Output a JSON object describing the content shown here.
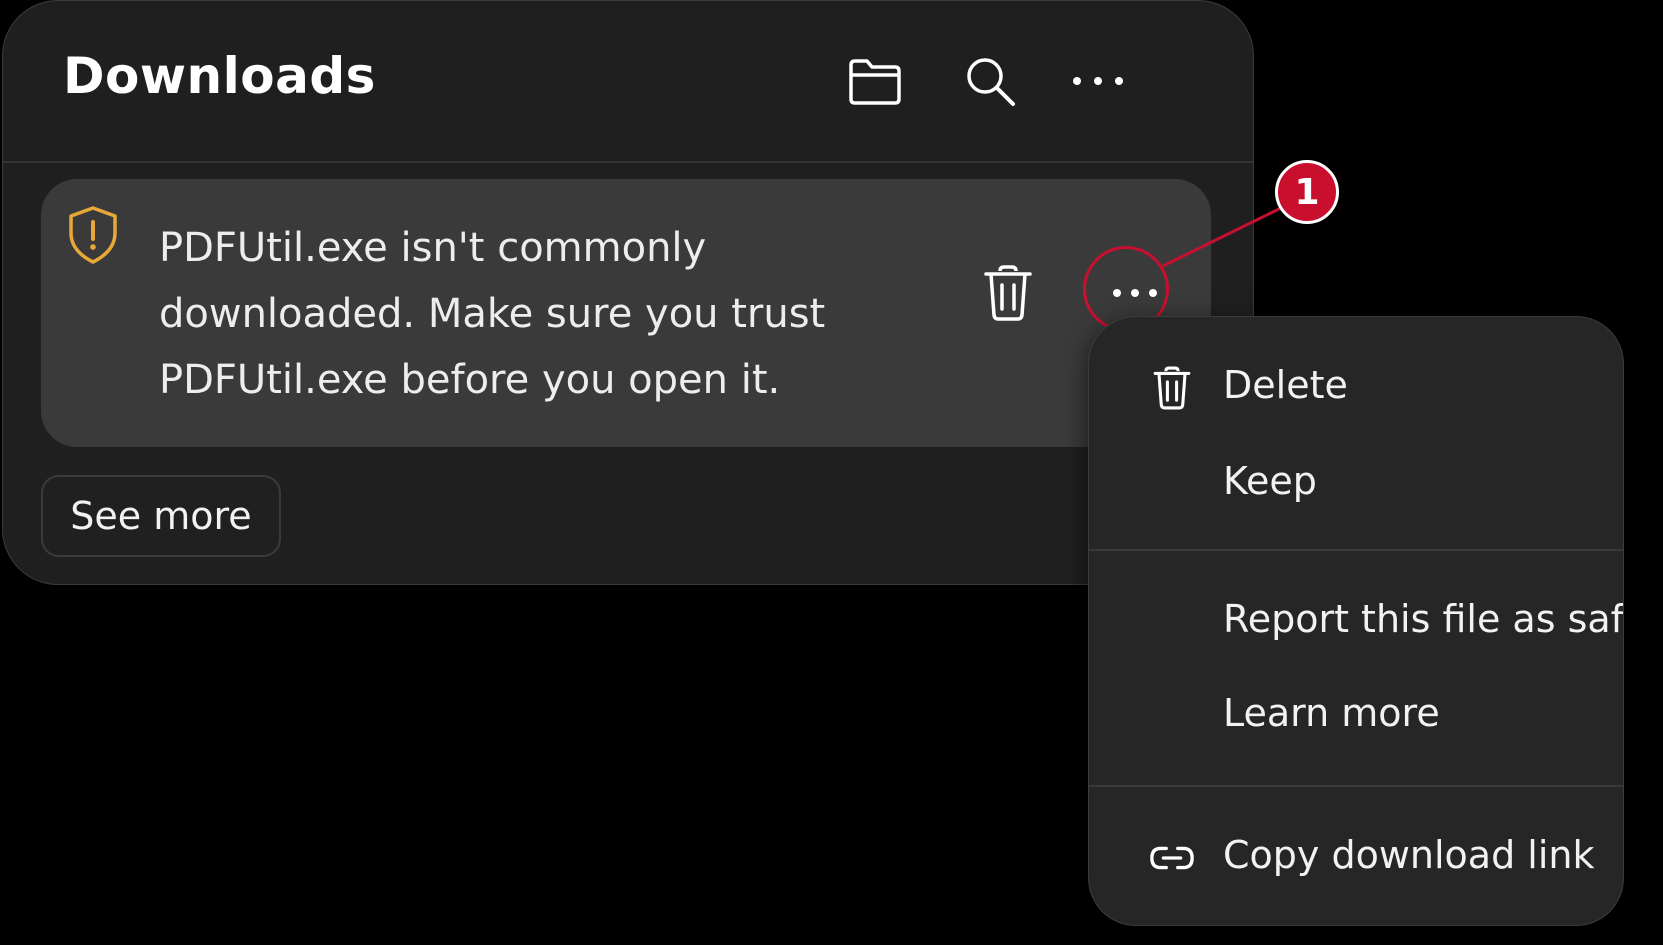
{
  "panel": {
    "title": "Downloads",
    "header_icons": [
      "folder-icon",
      "search-icon",
      "more-options-icon"
    ]
  },
  "warning_card": {
    "icon": "shield-warning-icon",
    "message": "PDFUtil.exe isn't commonly downloaded. Make sure you trust PDFUtil.exe before you open it.",
    "delete_icon": "trash-icon",
    "more_icon": "more-options-icon"
  },
  "see_more_label": "See more",
  "callout": {
    "number": "1"
  },
  "context_menu": {
    "items": [
      {
        "label": "Delete",
        "icon": "trash-icon"
      },
      {
        "label": "Keep",
        "icon": ""
      },
      {
        "label": "Report this file as safe",
        "icon": ""
      },
      {
        "label": "Learn more",
        "icon": ""
      },
      {
        "label": "Copy download link",
        "icon": "link-icon"
      }
    ]
  },
  "colors": {
    "accent_warning": "#e8a838",
    "callout_red": "#c8102e",
    "panel_bg": "#1f1f1f",
    "card_bg": "#3a3a3a"
  }
}
